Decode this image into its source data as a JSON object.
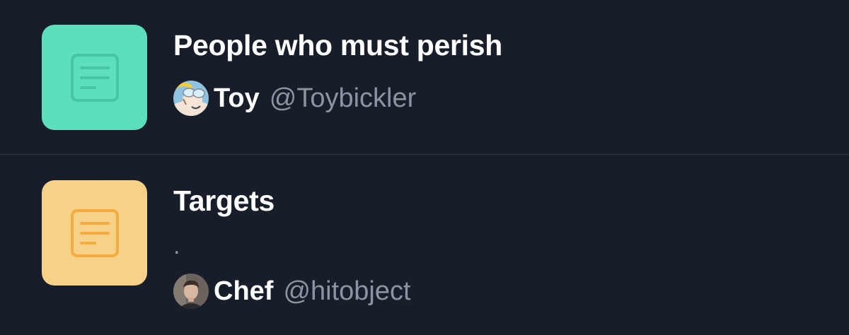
{
  "lists": [
    {
      "title": "People who must perish",
      "description": "",
      "thumb_color": "#5ddfbc",
      "thumb_icon_color": "#48c5a2",
      "thumb_icon": "list-document-icon",
      "owner": {
        "name": "Toy",
        "handle": "@Toybickler",
        "avatar": "cartoon-avatar"
      }
    },
    {
      "title": "Targets",
      "description": ".",
      "thumb_color": "#f8d189",
      "thumb_icon_color": "#f2ac40",
      "thumb_icon": "list-document-icon",
      "owner": {
        "name": "Chef",
        "handle": "@hitobject",
        "avatar": "photo-avatar"
      }
    }
  ],
  "colors": {
    "background": "#171e2a",
    "divider": "#2f3846",
    "primary_text": "#ffffff",
    "secondary_text": "#8a94a3"
  }
}
